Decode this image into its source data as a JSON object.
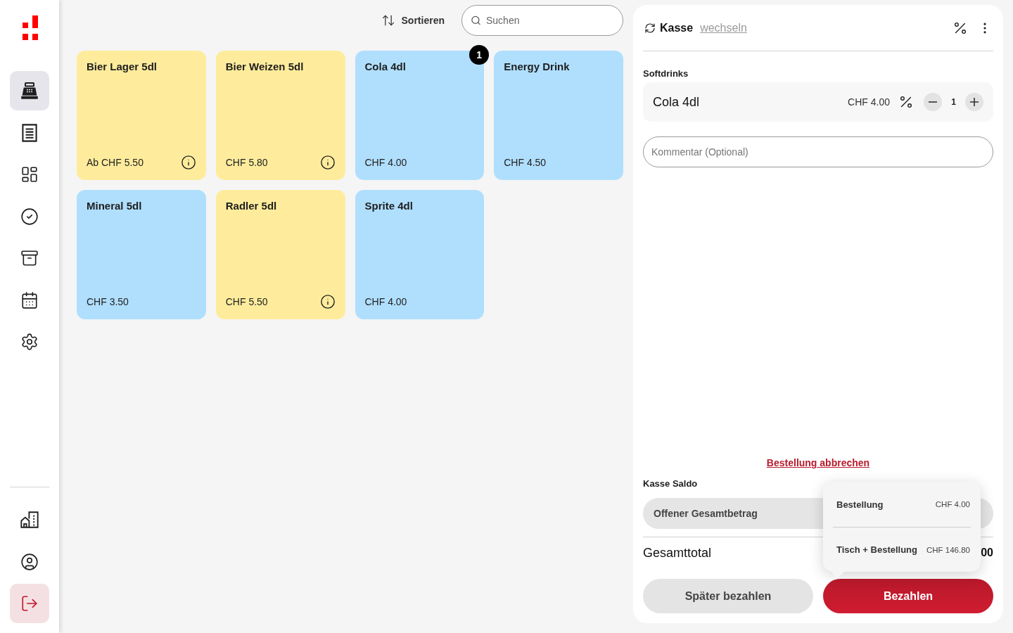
{
  "sidebar": {
    "nav_items": [
      {
        "selected": true
      },
      {
        "selected": false
      },
      {
        "selected": false
      },
      {
        "selected": false
      },
      {
        "selected": false
      },
      {
        "selected": false
      },
      {
        "selected": false
      }
    ],
    "bottom_items": [
      {
        "kind": "plain"
      },
      {
        "kind": "plain"
      },
      {
        "kind": "danger"
      }
    ]
  },
  "toolbar": {
    "sort_button": "Sortieren",
    "search": {
      "placeholder": "Suchen"
    }
  },
  "products": [
    {
      "name": "Bier Lager 5dl",
      "price": "Ab CHF 5.50",
      "color": "#feec9c",
      "info": true
    },
    {
      "name": "Bier Weizen 5dl",
      "price": "CHF 5.80",
      "color": "#feec9c",
      "info": true
    },
    {
      "name": "Cola 4dl",
      "price": "CHF 4.00",
      "color": "#b0dffe",
      "info": false,
      "badge": "1"
    },
    {
      "name": "Energy Drink",
      "price": "CHF 4.50",
      "color": "#b0dffe",
      "info": false
    },
    {
      "name": "Mineral 5dl",
      "price": "CHF 3.50",
      "color": "#b0dffe",
      "info": false
    },
    {
      "name": "Radler 5dl",
      "price": "CHF 5.50",
      "color": "#feec9c",
      "info": true
    },
    {
      "name": "Sprite 4dl",
      "price": "CHF 4.00",
      "color": "#b0dffe",
      "info": false
    }
  ],
  "order_panel": {
    "register": {
      "title": "Kasse",
      "switch_link": "wechseln"
    },
    "category": "Softdrinks",
    "items": [
      {
        "name": "Cola 4dl",
        "price": "CHF 4.00",
        "quantity": "1"
      }
    ],
    "comment": {
      "placeholder": "Kommentar (Optional)"
    },
    "cancel_link": "Bestellung abbrechen",
    "balance": {
      "title": "Kasse Saldo",
      "open_total_label": "Offener Gesamtbetrag"
    },
    "total": {
      "label": "Gesamttotal",
      "value": "00"
    },
    "buttons": [
      {
        "label": "Später bezahlen",
        "kind": "secondary"
      },
      {
        "label": "Bezahlen",
        "kind": "primary"
      }
    ],
    "pay_popover": {
      "options": [
        {
          "label": "Bestellung",
          "amount": "CHF 4.00"
        },
        {
          "label": "Tisch + Bestellung",
          "amount": "CHF 146.80"
        }
      ]
    }
  }
}
